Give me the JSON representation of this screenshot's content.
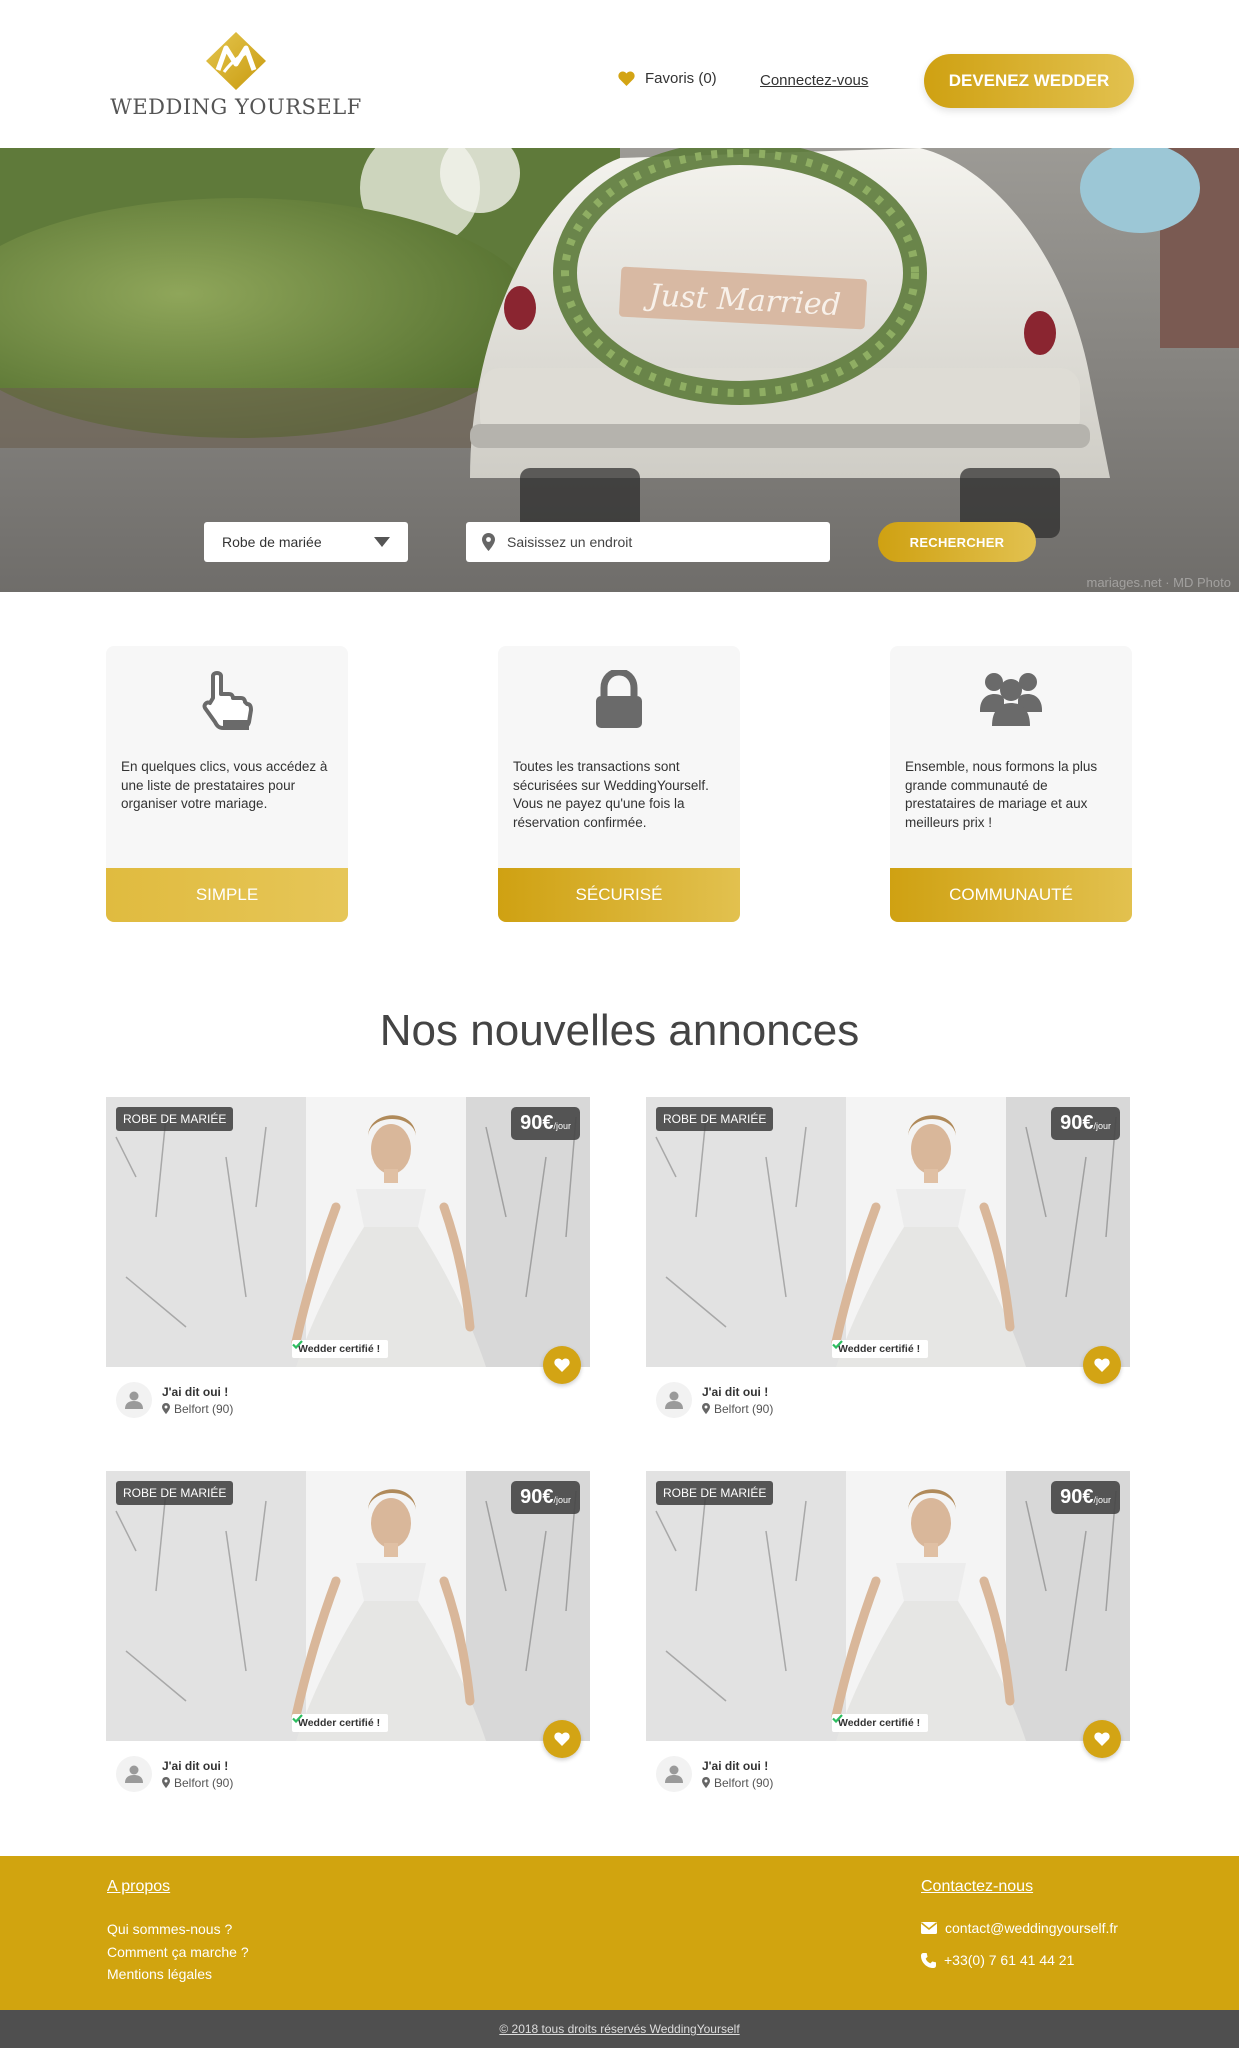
{
  "header": {
    "brand": "WEDDING YOURSELF",
    "favorites_label": "Favoris (0)",
    "connect_label": "Connectez-vous",
    "cta_label": "DEVENEZ WEDDER"
  },
  "hero": {
    "category_selected": "Robe de mariée",
    "location_placeholder": "Saisissez un endroit",
    "search_label": "RECHERCHER",
    "photo_sign_text": "Just Married",
    "watermark": "mariages.net · MD Photo"
  },
  "features": [
    {
      "icon": "pointer-hand-icon",
      "text": "En quelques clics, vous accédez à une liste de prestataires pour organiser votre mariage.",
      "button": "SIMPLE"
    },
    {
      "icon": "lock-icon",
      "text": "Toutes les transactions sont sécurisées sur WeddingYourself. Vous ne payez qu'une fois la réservation confirmée.",
      "button": "SÉCURISÉ"
    },
    {
      "icon": "users-icon",
      "text": "Ensemble, nous formons la plus grande communauté de prestataires de mariage et aux meilleurs prix !",
      "button": "COMMUNAUTÉ"
    }
  ],
  "listings": {
    "title": "Nos nouvelles annonces",
    "items": [
      {
        "category": "ROBE DE MARIÉE",
        "price": "90€",
        "price_unit": "/jour",
        "certified": "Wedder certifié !",
        "seller": "J'ai dit oui !",
        "location": "Belfort (90)"
      },
      {
        "category": "ROBE DE MARIÉE",
        "price": "90€",
        "price_unit": "/jour",
        "certified": "Wedder certifié !",
        "seller": "J'ai dit oui !",
        "location": "Belfort (90)"
      },
      {
        "category": "ROBE DE MARIÉE",
        "price": "90€",
        "price_unit": "/jour",
        "certified": "Wedder certifié !",
        "seller": "J'ai dit oui !",
        "location": "Belfort (90)"
      },
      {
        "category": "ROBE DE MARIÉE",
        "price": "90€",
        "price_unit": "/jour",
        "certified": "Wedder certifié !",
        "seller": "J'ai dit oui !",
        "location": "Belfort (90)"
      }
    ]
  },
  "footer": {
    "about_title": "A propos",
    "about_links": [
      "Qui sommes-nous ?",
      "Comment ça marche ?",
      "Mentions légales"
    ],
    "contact_title": "Contactez-nous",
    "email": "contact@weddingyourself.fr",
    "phone": "+33(0) 7 61 41 44 21",
    "copyright": "© 2018 tous droits réservés WeddingYourself"
  },
  "colors": {
    "gold": "#D1A40F",
    "gold_light": "#E2C14F",
    "dark": "#4F4F4F",
    "certified_check": "#2DBE60"
  }
}
